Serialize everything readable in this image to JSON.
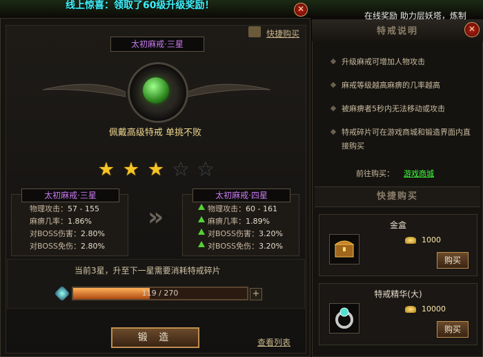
{
  "top": {
    "banner": "线上惊喜：领取了60级升级奖励！",
    "right_text": "在线奖励 助力层妖塔，炼制"
  },
  "left": {
    "quick_buy_label": "快捷购买",
    "ring_title": "太初麻戒·三星",
    "tagline": "佩戴高级特戒 单挑不败",
    "stars_lit": 3,
    "stars_total": 5,
    "current": {
      "title": "太初麻戒·三星",
      "stats": [
        {
          "label": "物理攻击：",
          "value": "57 - 155"
        },
        {
          "label": "麻痹几率：",
          "value": "1.86%"
        },
        {
          "label": "对BOSS伤害：",
          "value": "2.80%"
        },
        {
          "label": "对BOSS免伤：",
          "value": "2.80%"
        }
      ]
    },
    "next": {
      "title": "太初麻戒·四星",
      "stats": [
        {
          "label": "物理攻击：",
          "value": "60 - 161"
        },
        {
          "label": "麻痹几率：",
          "value": "1.89%"
        },
        {
          "label": "对BOSS伤害：",
          "value": "3.20%"
        },
        {
          "label": "对BOSS免伤：",
          "value": "3.20%"
        }
      ]
    },
    "progress_note": "当前3星，升至下一星需要消耗特戒碎片",
    "progress_current": 119,
    "progress_total": 270,
    "progress_text": "119 / 270",
    "plus_label": "+",
    "forge_label": "锻 造",
    "view_list_label": "查看列表",
    "close_label": "✕"
  },
  "right": {
    "title": "特戒说明",
    "close_label": "✕",
    "descriptions": [
      "升级麻戒可增加人物攻击",
      "麻戒等级越高麻痹的几率越高",
      "被麻痹者5秒内无法移动或攻击",
      "特戒碎片可在游戏商城和锻造界面内直接购买"
    ],
    "goto_label": "前往购买：",
    "goto_link": "游戏商城",
    "shop_title": "快捷购买",
    "items": [
      {
        "name": "金盒",
        "price": "1000",
        "buy": "购买",
        "icon": "treasure-chest-icon"
      },
      {
        "name": "特戒精华(大)",
        "price": "10000",
        "buy": "购买",
        "icon": "ring-essence-icon"
      }
    ]
  },
  "colors": {
    "star_on": "#f6c425",
    "title_purple": "#c87af0",
    "link_green": "#3cff3c",
    "banner_cyan": "#3ff2ff"
  }
}
